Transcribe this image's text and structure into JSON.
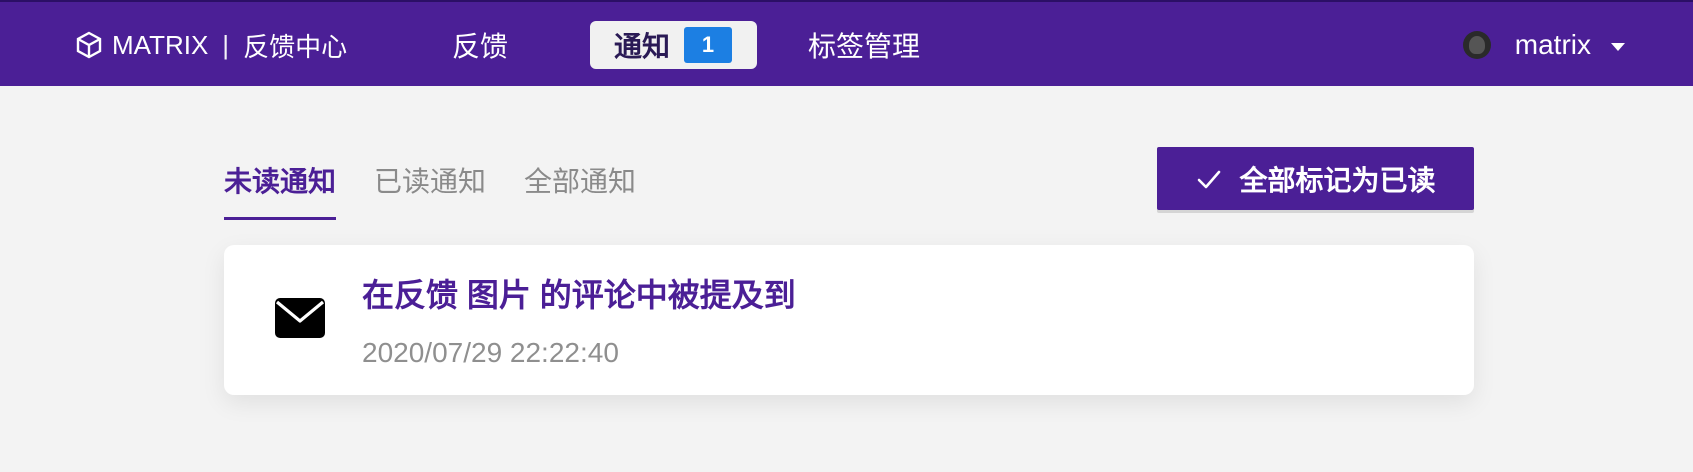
{
  "brand": {
    "name": "MATRIX",
    "separator": "|",
    "subtitle": "反馈中心"
  },
  "nav": {
    "items": [
      {
        "label": "反馈"
      },
      {
        "label": "通知",
        "badge": "1"
      },
      {
        "label": "标签管理"
      }
    ],
    "active_index": 1
  },
  "user": {
    "name": "matrix",
    "avatar_icon": "avatar-icon",
    "menu_icon": "caret-down-icon"
  },
  "tabs": [
    {
      "label": "未读通知"
    },
    {
      "label": "已读通知"
    },
    {
      "label": "全部通知"
    }
  ],
  "active_tab_index": 0,
  "actions": {
    "mark_all_read": "全部标记为已读",
    "mark_all_icon": "check-icon"
  },
  "notifications": [
    {
      "icon": "mail-icon",
      "title": "在反馈 图片 的评论中被提及到",
      "time": "2020/07/29 22:22:40"
    }
  ],
  "colors": {
    "brand": "#4b1f96",
    "badge": "#1c7fe3",
    "background": "#f3f3f3"
  }
}
